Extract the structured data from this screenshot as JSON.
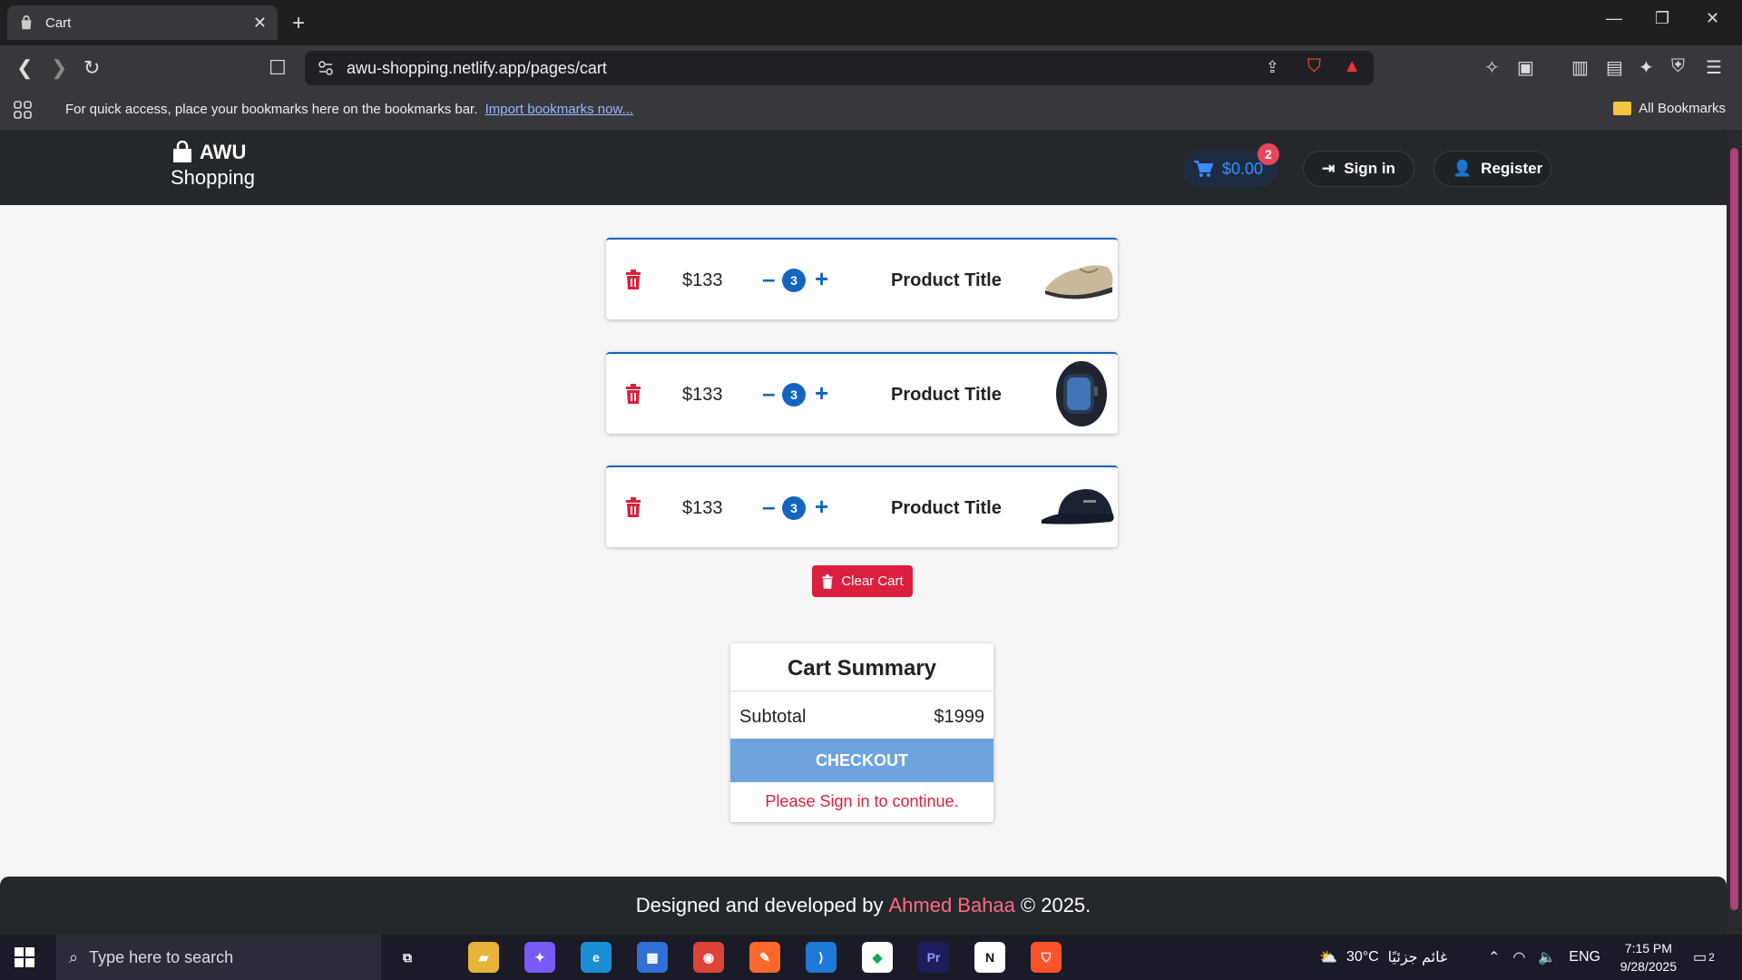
{
  "browser": {
    "tab_title": "Cart",
    "url": "awu-shopping.netlify.app/pages/cart",
    "bookmarks_message": "For quick access, place your bookmarks here on the bookmarks bar.",
    "import_link": "Import bookmarks now...",
    "all_bookmarks": "All Bookmarks"
  },
  "header": {
    "logo_top": "AWU",
    "logo_bottom": "Shopping",
    "cart_total": "$0.00",
    "cart_count": "2",
    "sign_in": "Sign in",
    "register": "Register"
  },
  "cart": {
    "items": [
      {
        "price": "$133",
        "quantity": "3",
        "title": "Product Title",
        "image": "shoe-image"
      },
      {
        "price": "$133",
        "quantity": "3",
        "title": "Product Title",
        "image": "watch-image"
      },
      {
        "price": "$133",
        "quantity": "3",
        "title": "Product Title",
        "image": "cap-image"
      }
    ],
    "minus": "–",
    "plus": "+",
    "clear_label": "Clear Cart"
  },
  "summary": {
    "title": "Cart Summary",
    "subtotal_label": "Subtotal",
    "subtotal_value": "$1999",
    "checkout_label": "CHECKOUT",
    "signin_warning": "Please Sign in to continue."
  },
  "footer": {
    "prefix": "Designed and developed by",
    "author": "Ahmed Bahaa",
    "suffix": "© 2025."
  },
  "taskbar": {
    "search_placeholder": "Type here to search",
    "weather": "30°C",
    "weather_desc": "غائم جزئيًا",
    "lang": "ENG",
    "time": "7:15 PM",
    "date": "9/28/2025",
    "notifications": "2"
  },
  "colors": {
    "accent_blue": "#1565c0",
    "danger_red": "#dc1f3e",
    "header_dark": "#25282b",
    "checkout_blue": "#6fa3dd",
    "author_pink": "#ff6b81"
  }
}
